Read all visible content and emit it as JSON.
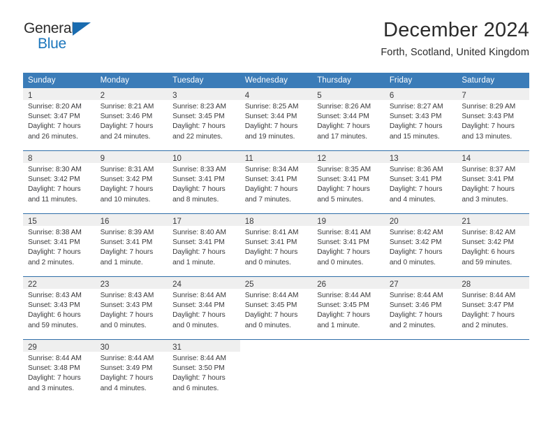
{
  "brand": {
    "name_top": "General",
    "name_bottom": "Blue",
    "triangle_color": "#1a6cb0",
    "blue_color": "#1b76bc"
  },
  "header": {
    "title": "December 2024",
    "subtitle": "Forth, Scotland, United Kingdom"
  },
  "theme": {
    "header_bg": "#3b7cb8",
    "daynum_bg": "#efefef",
    "row_divider": "#2f6ea8",
    "text": "#39393b"
  },
  "calendar": {
    "weekday_headers": [
      "Sunday",
      "Monday",
      "Tuesday",
      "Wednesday",
      "Thursday",
      "Friday",
      "Saturday"
    ],
    "weeks": [
      [
        {
          "day": "1",
          "sunrise": "Sunrise: 8:20 AM",
          "sunset": "Sunset: 3:47 PM",
          "daylight1": "Daylight: 7 hours",
          "daylight2": "and 26 minutes."
        },
        {
          "day": "2",
          "sunrise": "Sunrise: 8:21 AM",
          "sunset": "Sunset: 3:46 PM",
          "daylight1": "Daylight: 7 hours",
          "daylight2": "and 24 minutes."
        },
        {
          "day": "3",
          "sunrise": "Sunrise: 8:23 AM",
          "sunset": "Sunset: 3:45 PM",
          "daylight1": "Daylight: 7 hours",
          "daylight2": "and 22 minutes."
        },
        {
          "day": "4",
          "sunrise": "Sunrise: 8:25 AM",
          "sunset": "Sunset: 3:44 PM",
          "daylight1": "Daylight: 7 hours",
          "daylight2": "and 19 minutes."
        },
        {
          "day": "5",
          "sunrise": "Sunrise: 8:26 AM",
          "sunset": "Sunset: 3:44 PM",
          "daylight1": "Daylight: 7 hours",
          "daylight2": "and 17 minutes."
        },
        {
          "day": "6",
          "sunrise": "Sunrise: 8:27 AM",
          "sunset": "Sunset: 3:43 PM",
          "daylight1": "Daylight: 7 hours",
          "daylight2": "and 15 minutes."
        },
        {
          "day": "7",
          "sunrise": "Sunrise: 8:29 AM",
          "sunset": "Sunset: 3:43 PM",
          "daylight1": "Daylight: 7 hours",
          "daylight2": "and 13 minutes."
        }
      ],
      [
        {
          "day": "8",
          "sunrise": "Sunrise: 8:30 AM",
          "sunset": "Sunset: 3:42 PM",
          "daylight1": "Daylight: 7 hours",
          "daylight2": "and 11 minutes."
        },
        {
          "day": "9",
          "sunrise": "Sunrise: 8:31 AM",
          "sunset": "Sunset: 3:42 PM",
          "daylight1": "Daylight: 7 hours",
          "daylight2": "and 10 minutes."
        },
        {
          "day": "10",
          "sunrise": "Sunrise: 8:33 AM",
          "sunset": "Sunset: 3:41 PM",
          "daylight1": "Daylight: 7 hours",
          "daylight2": "and 8 minutes."
        },
        {
          "day": "11",
          "sunrise": "Sunrise: 8:34 AM",
          "sunset": "Sunset: 3:41 PM",
          "daylight1": "Daylight: 7 hours",
          "daylight2": "and 7 minutes."
        },
        {
          "day": "12",
          "sunrise": "Sunrise: 8:35 AM",
          "sunset": "Sunset: 3:41 PM",
          "daylight1": "Daylight: 7 hours",
          "daylight2": "and 5 minutes."
        },
        {
          "day": "13",
          "sunrise": "Sunrise: 8:36 AM",
          "sunset": "Sunset: 3:41 PM",
          "daylight1": "Daylight: 7 hours",
          "daylight2": "and 4 minutes."
        },
        {
          "day": "14",
          "sunrise": "Sunrise: 8:37 AM",
          "sunset": "Sunset: 3:41 PM",
          "daylight1": "Daylight: 7 hours",
          "daylight2": "and 3 minutes."
        }
      ],
      [
        {
          "day": "15",
          "sunrise": "Sunrise: 8:38 AM",
          "sunset": "Sunset: 3:41 PM",
          "daylight1": "Daylight: 7 hours",
          "daylight2": "and 2 minutes."
        },
        {
          "day": "16",
          "sunrise": "Sunrise: 8:39 AM",
          "sunset": "Sunset: 3:41 PM",
          "daylight1": "Daylight: 7 hours",
          "daylight2": "and 1 minute."
        },
        {
          "day": "17",
          "sunrise": "Sunrise: 8:40 AM",
          "sunset": "Sunset: 3:41 PM",
          "daylight1": "Daylight: 7 hours",
          "daylight2": "and 1 minute."
        },
        {
          "day": "18",
          "sunrise": "Sunrise: 8:41 AM",
          "sunset": "Sunset: 3:41 PM",
          "daylight1": "Daylight: 7 hours",
          "daylight2": "and 0 minutes."
        },
        {
          "day": "19",
          "sunrise": "Sunrise: 8:41 AM",
          "sunset": "Sunset: 3:41 PM",
          "daylight1": "Daylight: 7 hours",
          "daylight2": "and 0 minutes."
        },
        {
          "day": "20",
          "sunrise": "Sunrise: 8:42 AM",
          "sunset": "Sunset: 3:42 PM",
          "daylight1": "Daylight: 7 hours",
          "daylight2": "and 0 minutes."
        },
        {
          "day": "21",
          "sunrise": "Sunrise: 8:42 AM",
          "sunset": "Sunset: 3:42 PM",
          "daylight1": "Daylight: 6 hours",
          "daylight2": "and 59 minutes."
        }
      ],
      [
        {
          "day": "22",
          "sunrise": "Sunrise: 8:43 AM",
          "sunset": "Sunset: 3:43 PM",
          "daylight1": "Daylight: 6 hours",
          "daylight2": "and 59 minutes."
        },
        {
          "day": "23",
          "sunrise": "Sunrise: 8:43 AM",
          "sunset": "Sunset: 3:43 PM",
          "daylight1": "Daylight: 7 hours",
          "daylight2": "and 0 minutes."
        },
        {
          "day": "24",
          "sunrise": "Sunrise: 8:44 AM",
          "sunset": "Sunset: 3:44 PM",
          "daylight1": "Daylight: 7 hours",
          "daylight2": "and 0 minutes."
        },
        {
          "day": "25",
          "sunrise": "Sunrise: 8:44 AM",
          "sunset": "Sunset: 3:45 PM",
          "daylight1": "Daylight: 7 hours",
          "daylight2": "and 0 minutes."
        },
        {
          "day": "26",
          "sunrise": "Sunrise: 8:44 AM",
          "sunset": "Sunset: 3:45 PM",
          "daylight1": "Daylight: 7 hours",
          "daylight2": "and 1 minute."
        },
        {
          "day": "27",
          "sunrise": "Sunrise: 8:44 AM",
          "sunset": "Sunset: 3:46 PM",
          "daylight1": "Daylight: 7 hours",
          "daylight2": "and 2 minutes."
        },
        {
          "day": "28",
          "sunrise": "Sunrise: 8:44 AM",
          "sunset": "Sunset: 3:47 PM",
          "daylight1": "Daylight: 7 hours",
          "daylight2": "and 2 minutes."
        }
      ],
      [
        {
          "day": "29",
          "sunrise": "Sunrise: 8:44 AM",
          "sunset": "Sunset: 3:48 PM",
          "daylight1": "Daylight: 7 hours",
          "daylight2": "and 3 minutes."
        },
        {
          "day": "30",
          "sunrise": "Sunrise: 8:44 AM",
          "sunset": "Sunset: 3:49 PM",
          "daylight1": "Daylight: 7 hours",
          "daylight2": "and 4 minutes."
        },
        {
          "day": "31",
          "sunrise": "Sunrise: 8:44 AM",
          "sunset": "Sunset: 3:50 PM",
          "daylight1": "Daylight: 7 hours",
          "daylight2": "and 6 minutes."
        },
        {
          "day": "",
          "sunrise": "",
          "sunset": "",
          "daylight1": "",
          "daylight2": ""
        },
        {
          "day": "",
          "sunrise": "",
          "sunset": "",
          "daylight1": "",
          "daylight2": ""
        },
        {
          "day": "",
          "sunrise": "",
          "sunset": "",
          "daylight1": "",
          "daylight2": ""
        },
        {
          "day": "",
          "sunrise": "",
          "sunset": "",
          "daylight1": "",
          "daylight2": ""
        }
      ]
    ]
  }
}
